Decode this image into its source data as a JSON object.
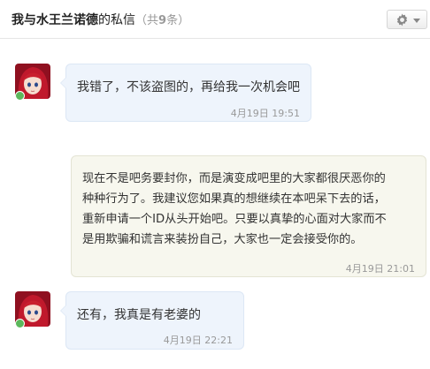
{
  "header": {
    "name_part1": "我与",
    "contact_name": "水王兰诺德",
    "name_part2": "的私信",
    "count_open": "（共",
    "count": "9",
    "count_close": "条）",
    "settings_icon": "gear-icon",
    "dropdown_icon": "caret-down-icon"
  },
  "messages": [
    {
      "side": "left",
      "text": "我错了，不该盗图的，再给我一次机会吧",
      "time": "4月19日 19:51"
    },
    {
      "side": "right",
      "text_line1": "现在不是吧务要封你，而是演变成吧里的大家都很厌恶你的",
      "text_line2": "种种行为了。我建议您如果真的想继续在本吧呆下去的话，",
      "text_line3": "重新申请一个ID从头开始吧。只要以真挚的心面对大家而不",
      "text_line4": "是用欺骗和谎言来装扮自己，大家也一定会接受你的。",
      "time": "4月19日 21:01"
    },
    {
      "side": "left",
      "text": "还有，我真是有老婆的",
      "time": "4月19日 22:21"
    }
  ],
  "colors": {
    "left_bubble": "#eef4fc",
    "right_bubble": "#f7f7ee",
    "avatar_hair": "#c0192c",
    "online_dot": "#5cb85c"
  }
}
